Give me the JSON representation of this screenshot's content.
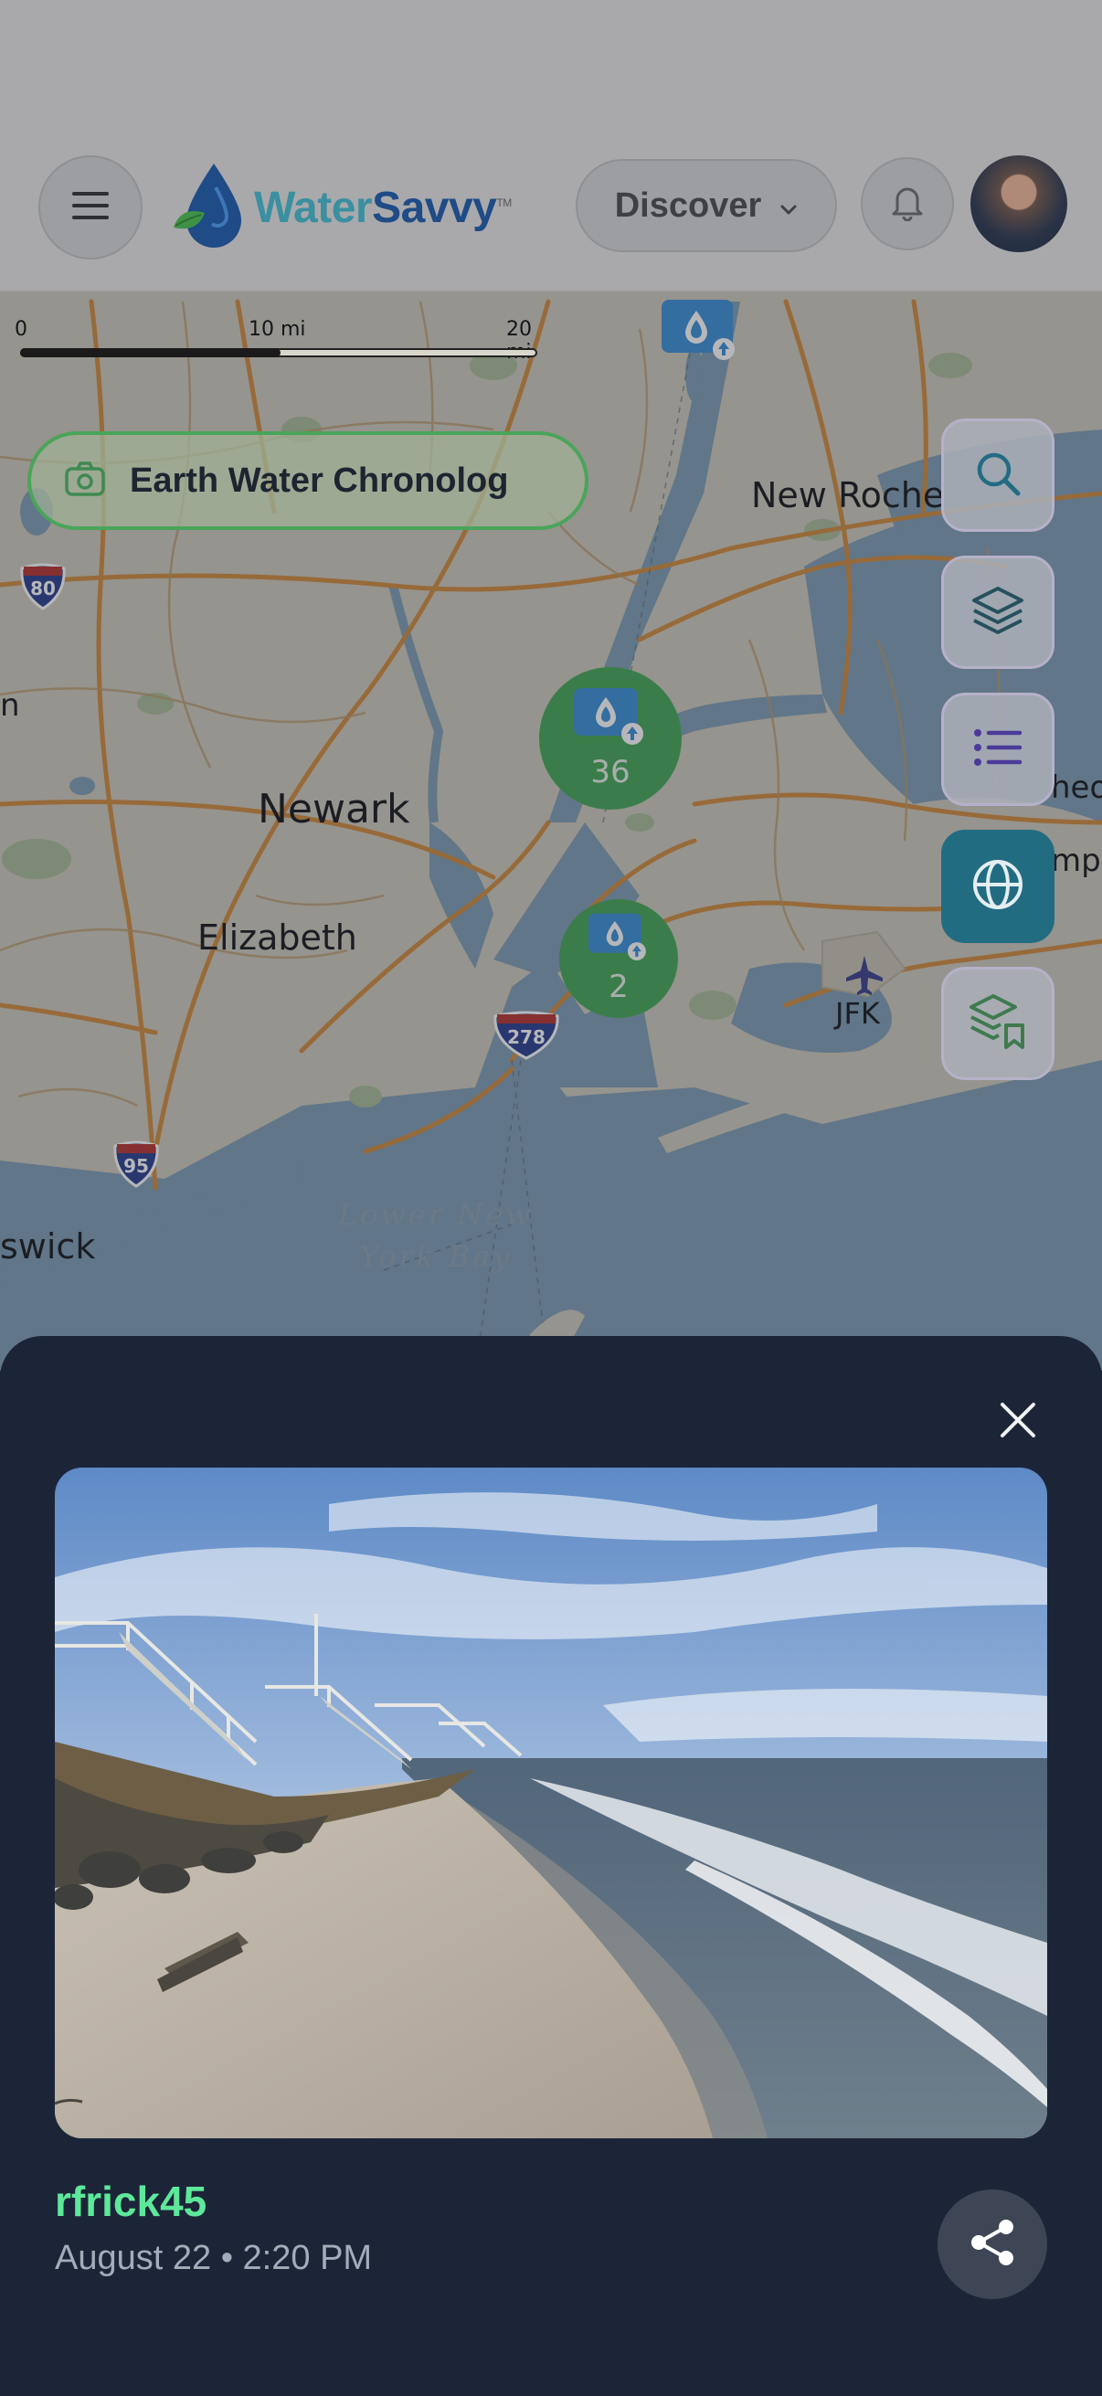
{
  "header": {
    "app_name_part1": "Water",
    "app_name_part2": "Savvy",
    "trademark": "TM",
    "discover_label": "Discover",
    "icons": {
      "menu": "hamburger-menu-icon",
      "logo": "water-drop-leaf-icon",
      "discover": "chevron-down-icon",
      "notifications": "bell-icon",
      "profile": "avatar"
    }
  },
  "map": {
    "scale": {
      "label_0": "0",
      "label_10": "10 mi",
      "label_20": "20 mi"
    },
    "chronolog_label": "Earth Water Chronolog",
    "places": {
      "newark": "Newark",
      "elizabeth": "Elizabeth",
      "new_rochelle": "New Roche",
      "brunswick": "swick",
      "jfk": "JFK",
      "heol": "heol",
      "mps": "mps",
      "n": "n",
      "bay_line1": "Lower New",
      "bay_line2": "York Bay"
    },
    "highway_shields": {
      "i80": "80",
      "i95": "95",
      "i278": "278"
    },
    "clusters": [
      {
        "count": "36"
      },
      {
        "count": "2"
      }
    ],
    "rail_icons": [
      "search-icon",
      "layers-icon",
      "list-icon",
      "globe-icon",
      "saved-layers-icon"
    ],
    "colors": {
      "cluster": "#44a855",
      "globe_active": "#226c82",
      "chronolog_border": "#4aa45a"
    }
  },
  "sheet": {
    "username": "rfrick45",
    "timestamp": "August 22 • 2:20 PM",
    "icons": {
      "close": "close-icon",
      "share": "share-icon"
    },
    "colors": {
      "username": "#5ee89a",
      "background": "#1c2538"
    }
  }
}
